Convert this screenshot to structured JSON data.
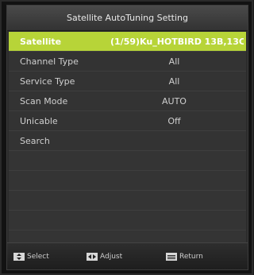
{
  "title": "Satellite AutoTuning Setting",
  "menu": [
    {
      "label": "Satellite",
      "value": "(1/59)Ku_HOTBIRD 13B,13C..."
    },
    {
      "label": "Channel Type",
      "value": "All"
    },
    {
      "label": "Service Type",
      "value": "All"
    },
    {
      "label": "Scan Mode",
      "value": "AUTO"
    },
    {
      "label": "Unicable",
      "value": "Off"
    },
    {
      "label": "Search",
      "value": ""
    }
  ],
  "footer": {
    "select_label": "Select",
    "adjust_label": "Adjust",
    "return_label": "Return"
  },
  "colors": {
    "highlight": "#b7d438",
    "row": "#333333",
    "background": "#2b2b2b"
  },
  "icons": {
    "select": "updown-arrows-icon",
    "adjust": "leftright-arrows-icon",
    "return": "menu-key-icon"
  }
}
